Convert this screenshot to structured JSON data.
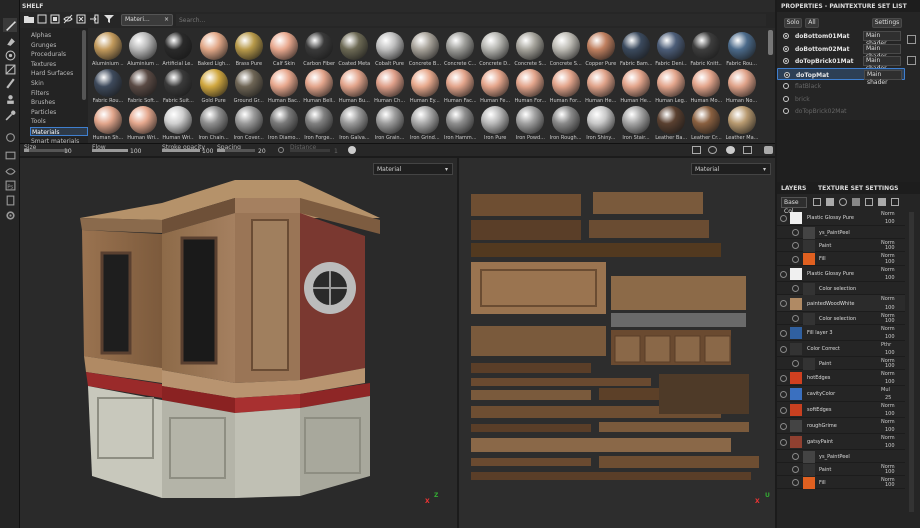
{
  "shelf": {
    "title": "SHELF",
    "filter_tag": "Materi...",
    "filter_close": "×",
    "search_placeholder": "Search...",
    "categories": [
      "Alphas",
      "Grunges",
      "Procedurals",
      "Textures",
      "Hard Surfaces",
      "Skin",
      "Filters",
      "Brushes",
      "Particles",
      "Tools",
      "Materials",
      "Smart materials"
    ],
    "selected_category": "Materials",
    "materials_row1": [
      "Aluminium ...",
      "Aluminium ...",
      "Artificial Le...",
      "Baked Ligh...",
      "Brass Pure",
      "Calf Skin",
      "Carbon Fiber",
      "Coated Metal",
      "Cobalt Pure",
      "Concrete B...",
      "Concrete C...",
      "Concrete D...",
      "Concrete S...",
      "Concrete S...",
      "Copper Pure",
      "Fabric Bam...",
      "Fabric Deni...",
      "Fabric Knitt...",
      "Fabric Rou..."
    ],
    "materials_row2": [
      "Fabric Rou...",
      "Fabric Soft...",
      "Fabric Suit...",
      "Gold Pure",
      "Ground Gr...",
      "Human Bac...",
      "Human Bell...",
      "Human Bu...",
      "Human Ch...",
      "Human Ey...",
      "Human Fac...",
      "Human Fe...",
      "Human For...",
      "Human For...",
      "Human He...",
      "Human He...",
      "Human Leg...",
      "Human Mo...",
      "Human No..."
    ],
    "materials_row3": [
      "Human Sh...",
      "Human Wri...",
      "Human Wri...",
      "Iron Chain...",
      "Iron Cover...",
      "Iron Diamo...",
      "Iron Forge...",
      "Iron Galva...",
      "Iron Grain...",
      "Iron Grind...",
      "Iron Hamm...",
      "Iron Pure",
      "Iron Powd...",
      "Iron Rough...",
      "Iron Shiny...",
      "Iron Stair...",
      "Leather Ba...",
      "Leather Cr...",
      "Leather Ma..."
    ]
  },
  "colors": {
    "accent": "#3f7fcf",
    "balls_row1": [
      "#c29a5c",
      "#b9b9b9",
      "#2a2a2a",
      "#e2a888",
      "#b89a4a",
      "#e8a88e",
      "#3a3a3a",
      "#6d6a55",
      "#bfbfbf",
      "#a8a39a",
      "#9e9e9a",
      "#b5b5b0",
      "#a6a49c",
      "#bdbbb4",
      "#c08060",
      "#3b4a5e",
      "#4c5d78",
      "#3d3d3d",
      "#4b6a8a"
    ],
    "balls_row2": [
      "#3e4a5c",
      "#5a4a44",
      "#3a3a3a",
      "#d1a840",
      "#6e6555",
      "#e8a88e",
      "#e3a58c",
      "#e3a58c",
      "#dfa08a",
      "#e8aa8e",
      "#e3a58c",
      "#e5a68c",
      "#e3a58c",
      "#e3a58c",
      "#e0a38a",
      "#e3a58c",
      "#e3a58c",
      "#e3a58c",
      "#e0a38a"
    ],
    "balls_row3": [
      "#e2a68c",
      "#e5a88e",
      "#cfcfcf",
      "#8f8f8f",
      "#9a9a9a",
      "#7a7a7a",
      "#808080",
      "#9a9a9a",
      "#9c9c9c",
      "#a9a9a9",
      "#8e8e8e",
      "#b8b8b8",
      "#a0a0a0",
      "#8a8a8a",
      "#c8c8c8",
      "#a5a5a5",
      "#5a4030",
      "#8a6040",
      "#b89a70"
    ]
  },
  "brushbar": {
    "size_label": "Size",
    "size_value": "10",
    "flow_label": "Flow",
    "flow_value": "100",
    "opacity_label": "Stroke opacity",
    "opacity_value": "100",
    "spacing_label": "Spacing",
    "spacing_value": "20",
    "distance_label": "Distance",
    "distance_value": "1"
  },
  "viewport": {
    "left_mode": "Material",
    "right_mode": "Material",
    "gizmo_left_x": "X",
    "gizmo_left_z": "Z",
    "gizmo_right_x": "X",
    "gizmo_right_u": "U"
  },
  "properties": {
    "title": "PROPERTIES - PAINT"
  },
  "texture_set_list": {
    "title": "TEXTURE SET LIST",
    "solo_label": "Solo",
    "all_label": "All",
    "settings_label": "Settings",
    "sets": [
      {
        "name": "doBottom01Mat",
        "shader": "Main shader",
        "active": true
      },
      {
        "name": "doBottom02Mat",
        "shader": "Main shader",
        "active": true
      },
      {
        "name": "doTopBrick01Mat",
        "shader": "Main shader",
        "active": true
      },
      {
        "name": "doTopMat",
        "shader": "Main shader",
        "active": true
      },
      {
        "name": "flatBlack",
        "shader": "",
        "active": false
      },
      {
        "name": "brick",
        "shader": "",
        "active": false
      },
      {
        "name": "doTopBrick02Mat",
        "shader": "",
        "active": false
      }
    ],
    "selected": "doTopMat"
  },
  "layers_panel": {
    "title": "LAYERS",
    "tab2": "TEXTURE SET SETTINGS",
    "channel": "Base Col",
    "layers": [
      {
        "name": "Plastic Glossy Pure",
        "blend": "Norm",
        "opacity": "100"
      },
      {
        "name": "ys_PaintPeel",
        "blend": "",
        "opacity": ""
      },
      {
        "name": "Paint",
        "blend": "Norm",
        "opacity": "100"
      },
      {
        "name": "Fill",
        "blend": "Norm",
        "opacity": "100"
      },
      {
        "name": "Plastic Glossy Pure",
        "blend": "Norm",
        "opacity": "100"
      },
      {
        "name": "Color selection",
        "blend": "",
        "opacity": ""
      },
      {
        "name": "paintedWoodWhite",
        "blend": "Norm",
        "opacity": "100"
      },
      {
        "name": "Color selection",
        "blend": "Norm",
        "opacity": "100"
      },
      {
        "name": "Fill layer 3",
        "blend": "Norm",
        "opacity": "100"
      },
      {
        "name": "Color Correct",
        "blend": "Pthr",
        "opacity": "100"
      },
      {
        "name": "Paint",
        "blend": "Norm",
        "opacity": "100"
      },
      {
        "name": "hotEdges",
        "blend": "Norm",
        "opacity": "100"
      },
      {
        "name": "cavityColor",
        "blend": "Mul",
        "opacity": "25"
      },
      {
        "name": "softEdges",
        "blend": "Norm",
        "opacity": "100"
      },
      {
        "name": "roughGrime",
        "blend": "Norm",
        "opacity": "100"
      },
      {
        "name": "gatsyPaint",
        "blend": "Norm",
        "opacity": "100"
      },
      {
        "name": "ys_PaintPeel",
        "blend": "",
        "opacity": ""
      },
      {
        "name": "Paint",
        "blend": "Norm",
        "opacity": "100"
      },
      {
        "name": "Fill",
        "blend": "Norm",
        "opacity": "100"
      }
    ]
  }
}
